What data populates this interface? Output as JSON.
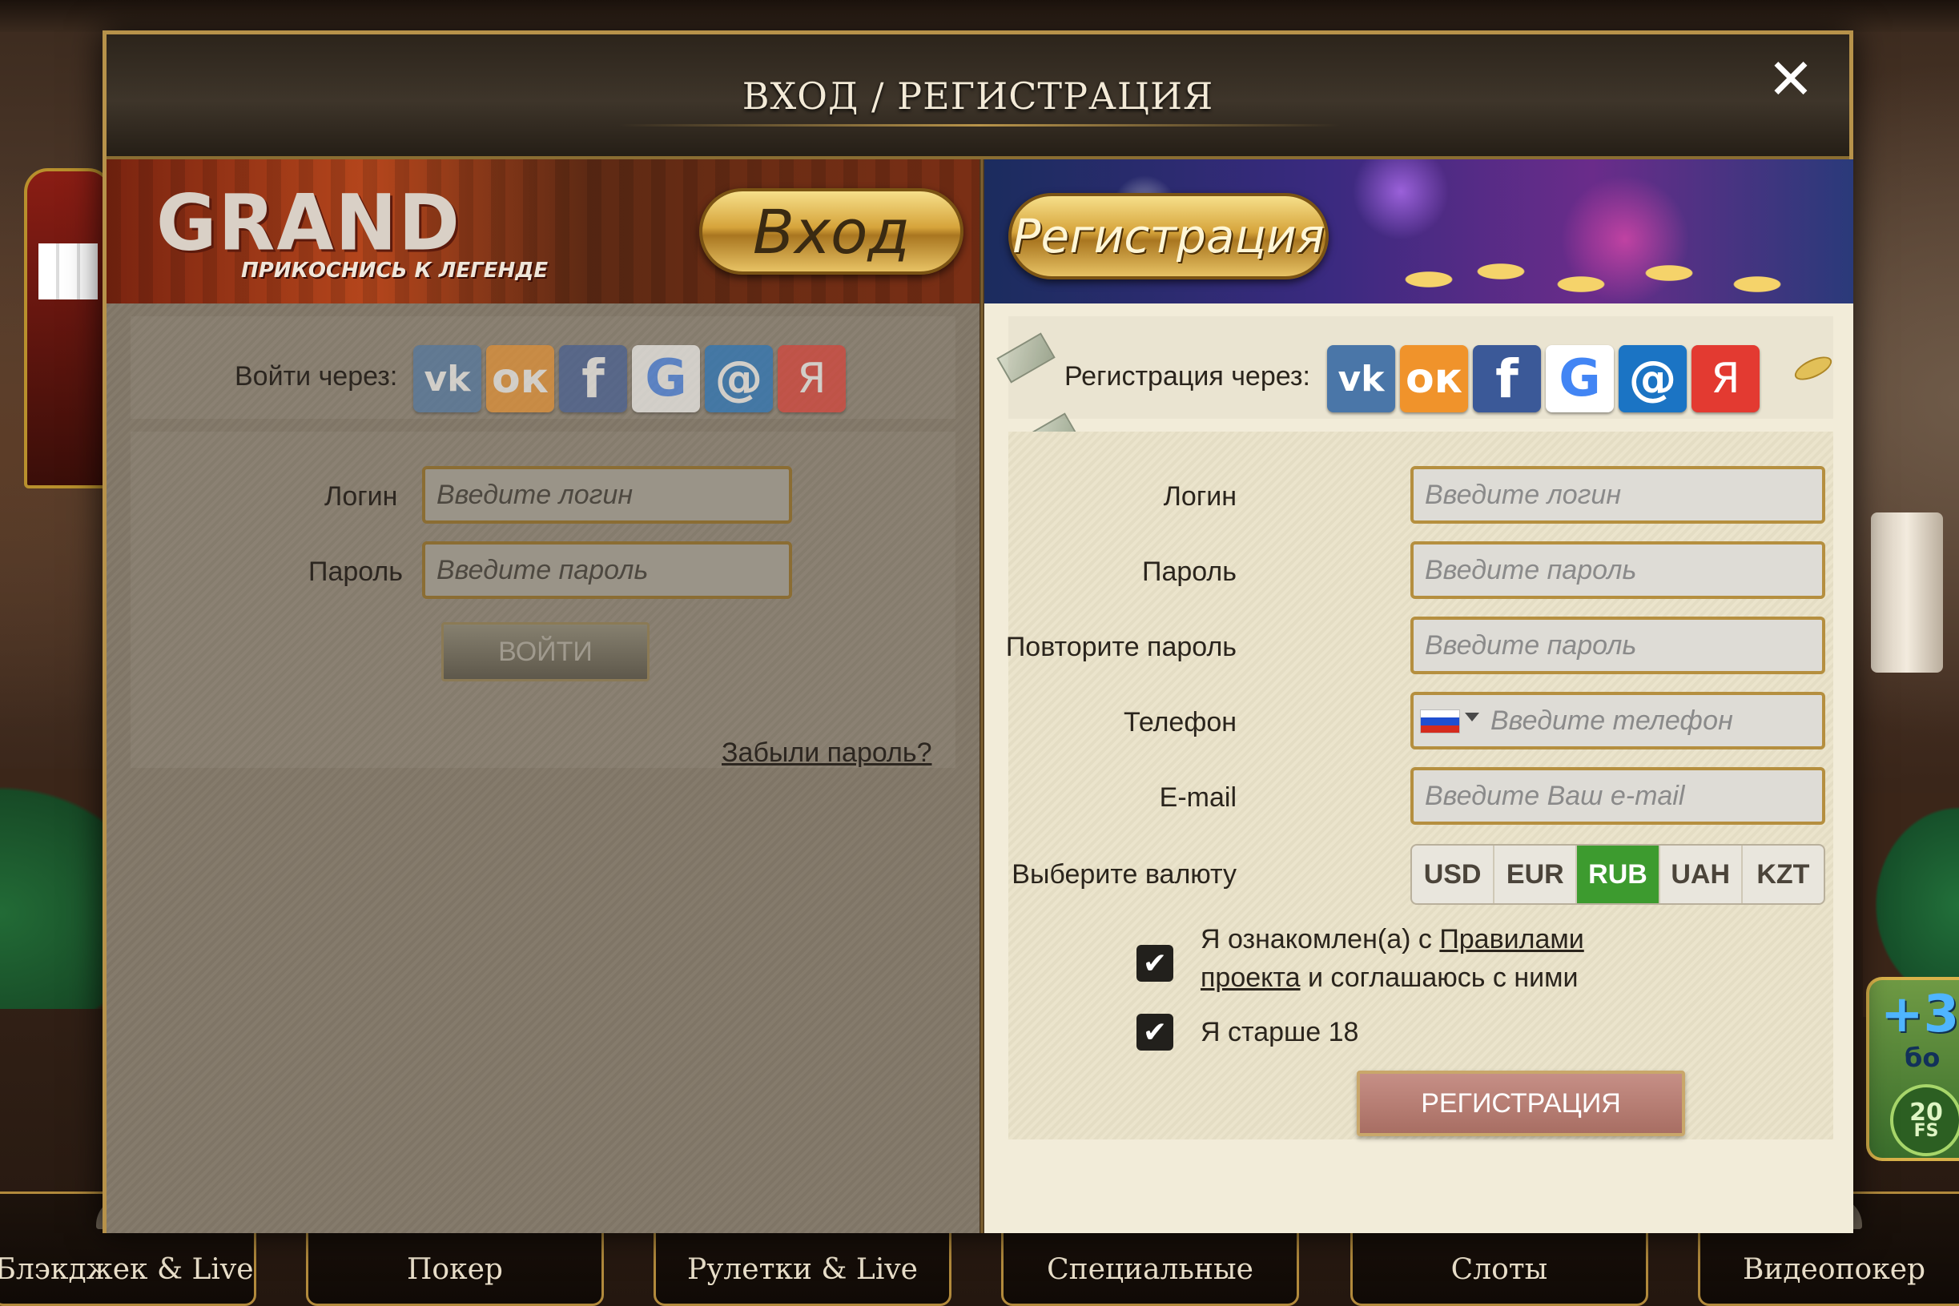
{
  "modal": {
    "title": "ВХОД / РЕГИСТРАЦИЯ",
    "close_symbol": "✕"
  },
  "login": {
    "banner_logo": "GRAND",
    "banner_tagline": "ПРИКОСНИСЬ К ЛЕГЕНДЕ",
    "banner_plaque": "Вход",
    "social_label": "Войти через:",
    "social_icons": [
      "vk-icon",
      "odnoklassniki-icon",
      "facebook-icon",
      "google-icon",
      "mailru-icon",
      "yandex-icon"
    ],
    "social_glyphs": {
      "vk": "vk",
      "ok": "ок",
      "fb": "f",
      "g": "G",
      "mail": "@",
      "ya": "Я"
    },
    "login_label": "Логин",
    "login_placeholder": "Введите логин",
    "password_label": "Пароль",
    "password_placeholder": "Введите пароль",
    "submit_label": "ВОЙТИ",
    "forgot_label": "Забыли пароль?"
  },
  "register": {
    "banner_plaque": "Регистрация",
    "social_label": "Регистрация через:",
    "login_label": "Логин",
    "login_placeholder": "Введите логин",
    "password_label": "Пароль",
    "password_placeholder": "Введите пароль",
    "repeat_label": "Повторите пароль",
    "repeat_placeholder": "Введите пароль",
    "phone_label": "Телефон",
    "phone_placeholder": "Введите телефон",
    "phone_country": "RU",
    "email_label": "E-mail",
    "email_placeholder": "Введите Ваш e-mail",
    "currency_label": "Выберите валюту",
    "currencies": [
      "USD",
      "EUR",
      "RUB",
      "UAH",
      "KZT"
    ],
    "selected_currency": "RUB",
    "agree_prefix": "Я ознакомлен(а) с ",
    "agree_link": "Правилами проекта",
    "agree_suffix": " и соглашаюсь с ними",
    "agree_checked": true,
    "age_label": "Я старше 18",
    "age_checked": true,
    "submit_label": "РЕГИСТРАЦИЯ"
  },
  "categories": [
    "Блэкджек & Live",
    "Покер",
    "Рулетки & Live",
    "Специальные",
    "Слоты",
    "Видеопокер"
  ],
  "bonus": {
    "amount": "+3",
    "sub": "бо",
    "fs": "20",
    "fs_label": "FS"
  },
  "colors": {
    "frame_gold": "#b7924a",
    "active_currency": "#3d9b2f",
    "register_button": "#b87a70",
    "login_button": "#6f6a5c"
  }
}
